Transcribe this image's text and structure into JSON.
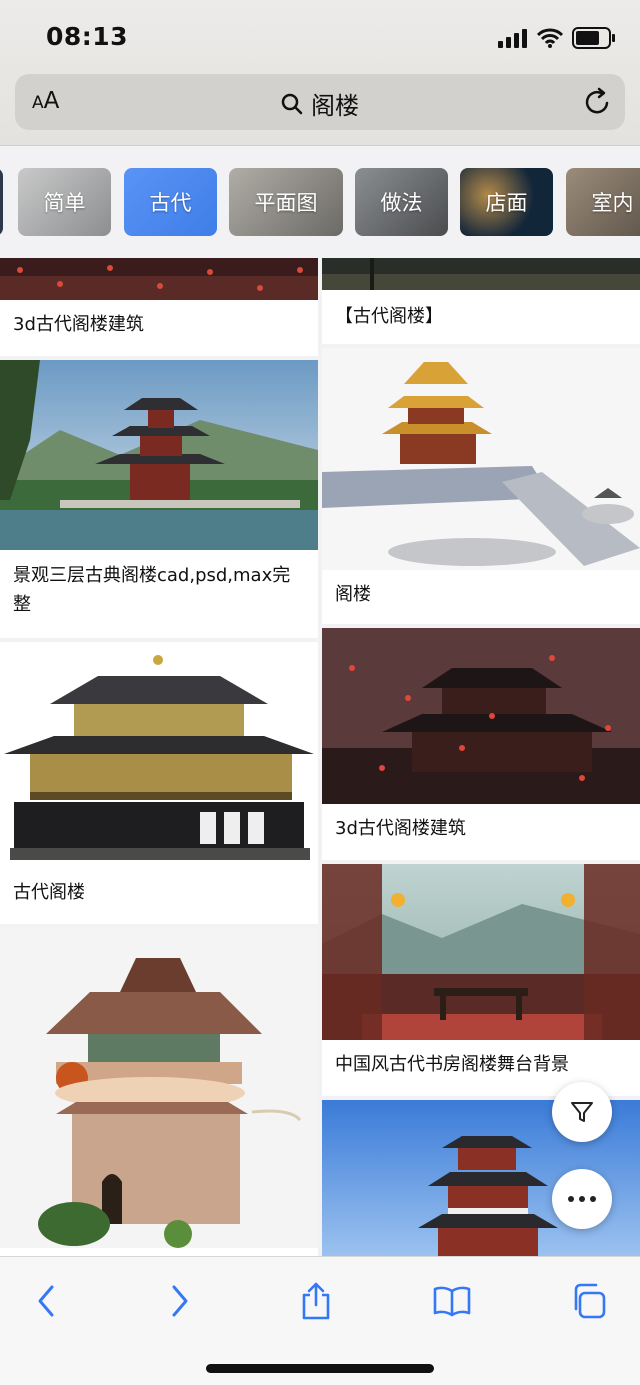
{
  "status_bar": {
    "time": "08:13"
  },
  "address_bar": {
    "text_size_label": "AA",
    "query": "阁楼"
  },
  "chips": [
    "简单",
    "古代",
    "平面图",
    "做法",
    "店面",
    "室内"
  ],
  "results": {
    "left": [
      {
        "caption": "3d古代阁楼建筑"
      },
      {
        "caption": "景观三层古典阁楼cad,psd,max完整"
      },
      {
        "caption": "古代阁楼"
      },
      {
        "caption": ""
      }
    ],
    "right": [
      {
        "caption": "【古代阁楼】"
      },
      {
        "caption": "阁楼"
      },
      {
        "caption": "3d古代阁楼建筑"
      },
      {
        "caption": "中国风古代书房阁楼舞台背景"
      },
      {
        "caption": ""
      }
    ]
  },
  "colors": {
    "accent": "#3478f6",
    "chip_selected": "#4a88f0"
  }
}
